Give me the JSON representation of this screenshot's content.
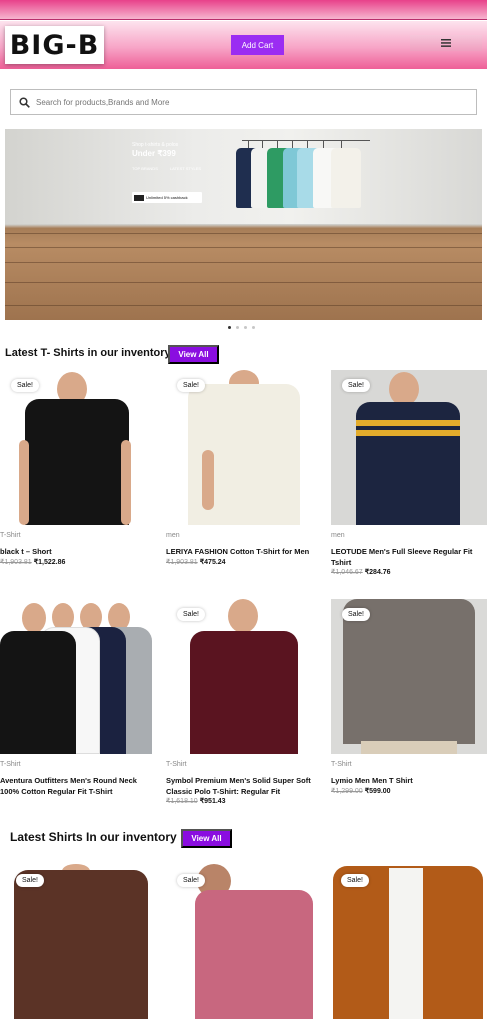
{
  "header": {
    "logo": "BIG-B",
    "add_cart_label": "Add Cart",
    "menu_icon": "hamburger-icon",
    "accent": "#9b2cf2"
  },
  "search": {
    "placeholder": "Search for products,Brands and More",
    "icon": "search-icon"
  },
  "banner": {
    "promo_line": "Shop t-shirts & polos",
    "promo_head": "Under ₹399",
    "tag_left": "TOP BRANDS",
    "tag_right": "LATEST STYLES",
    "cashback": "Unlimited 5% cashback",
    "slides_total": 4,
    "active_slide": 1
  },
  "sections": [
    {
      "title": "Latest T- Shirts in our inventory",
      "view_all": "View All",
      "products": [
        {
          "sale": "Sale!",
          "category": "T-Shirt",
          "name": "black t – Short",
          "old_price": "₹1,903.81",
          "price": "₹1,522.86"
        },
        {
          "sale": "Sale!",
          "category": "men",
          "name": "LERIYA FASHION Cotton T-Shirt for Men",
          "old_price": "₹1,903.81",
          "price": "₹475.24"
        },
        {
          "sale": "Sale!",
          "category": "men",
          "name": "LEOTUDE Men's Full Sleeve Regular Fit Tshirt",
          "old_price": "₹1,046.67",
          "price": "₹284.76"
        },
        {
          "sale": "",
          "category": "T-Shirt",
          "name": "Aventura Outfitters Men's Round Neck 100% Cotton Regular Fit T-Shirt",
          "old_price": "",
          "price": ""
        },
        {
          "sale": "Sale!",
          "category": "T-Shirt",
          "name": "Symbol Premium Men's Solid Super Soft Classic Polo T-Shirt: Regular Fit",
          "old_price": "₹1,618.10",
          "price": "₹951.43"
        },
        {
          "sale": "Sale!",
          "category": "T-Shirt",
          "name": "Lymio Men Men T Shirt",
          "old_price": "₹1,299.00",
          "price": "₹599.00"
        }
      ]
    },
    {
      "title": "Latest Shirts In our inventory",
      "view_all": "View All",
      "products": [
        {
          "sale": "Sale!"
        },
        {
          "sale": "Sale!"
        },
        {
          "sale": "Sale!"
        }
      ]
    }
  ]
}
